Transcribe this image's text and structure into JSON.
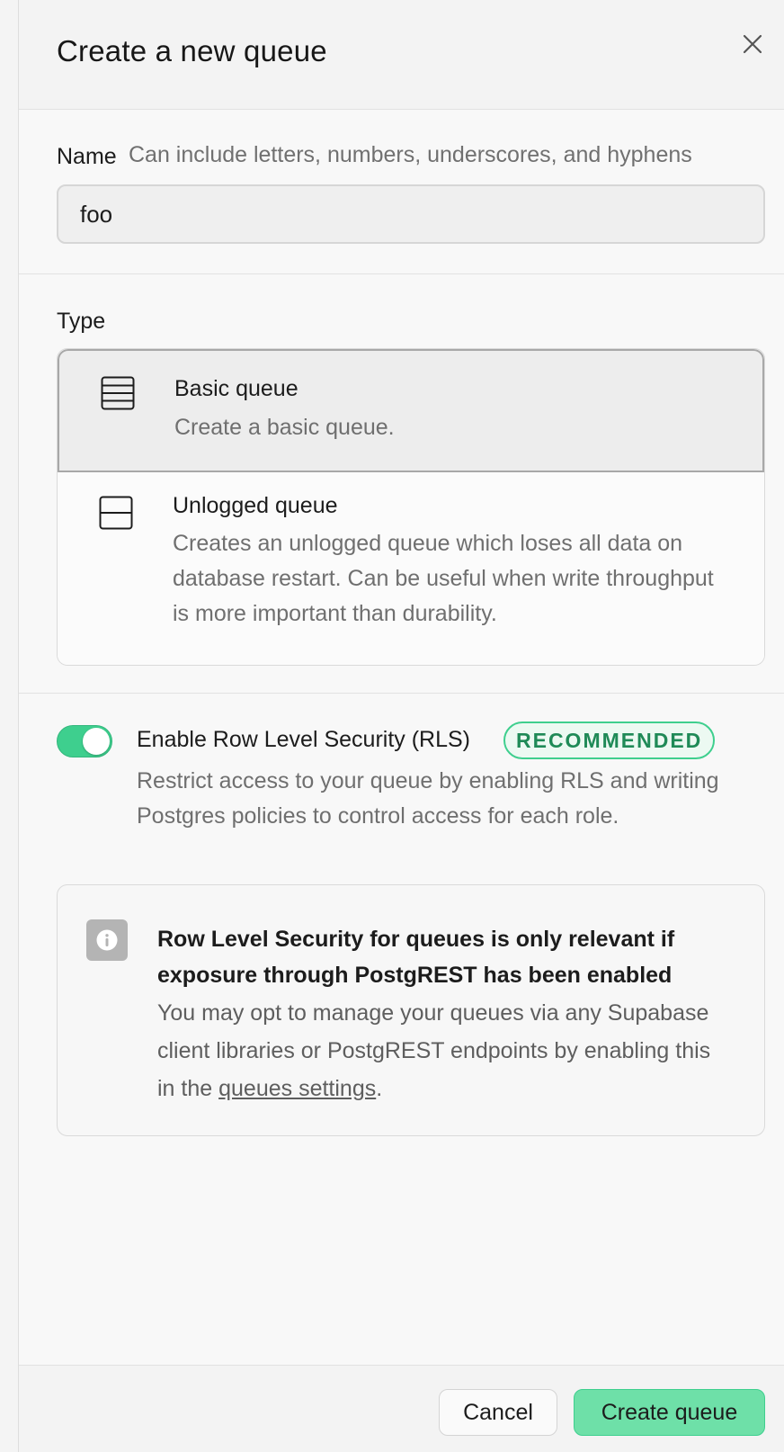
{
  "dialog": {
    "title": "Create a new queue"
  },
  "name_field": {
    "label": "Name",
    "hint": "Can include letters, numbers, underscores, and hyphens",
    "value": "foo"
  },
  "type": {
    "label": "Type",
    "selected": "basic",
    "options": [
      {
        "id": "basic",
        "title": "Basic queue",
        "description": "Create a basic queue.",
        "icon": "table-rows-icon"
      },
      {
        "id": "unlogged",
        "title": "Unlogged queue",
        "description": "Creates an unlogged queue which loses all data on database restart. Can be useful when write throughput is more important than durability.",
        "icon": "split-square-icon"
      }
    ]
  },
  "rls": {
    "enabled": true,
    "title": "Enable Row Level Security (RLS)",
    "badge": "RECOMMENDED",
    "description": "Restrict access to your queue by enabling RLS and writing Postgres policies to control access for each role."
  },
  "info": {
    "icon": "info-icon",
    "title": "Row Level Security for queues is only relevant if exposure through PostgREST has been enabled",
    "description_before": "You may opt to manage your queues via any Supabase client libraries or PostgREST endpoints by enabling this in the ",
    "link_text": "queues settings",
    "description_after": "."
  },
  "footer": {
    "cancel_label": "Cancel",
    "create_label": "Create queue"
  },
  "colors": {
    "accent": "#3ecf8e",
    "accent_button": "#6ee0a8",
    "badge_text": "#1f8a57"
  }
}
